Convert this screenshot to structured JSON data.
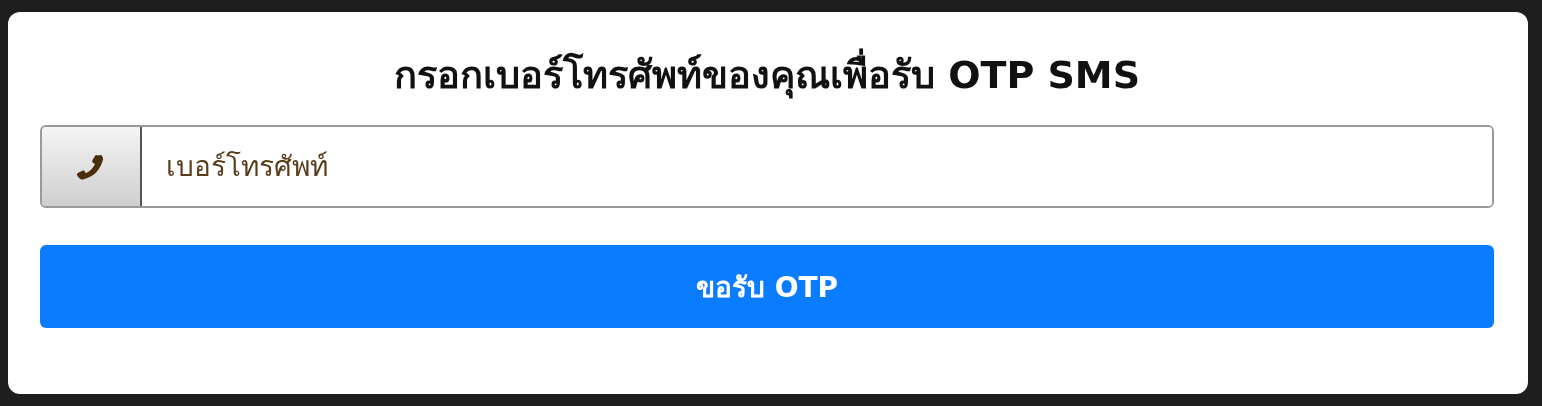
{
  "title": "กรอกเบอร์โทรศัพท์ของคุณเพื่อรับ OTP SMS",
  "phone_field": {
    "placeholder": "เบอร์โทรศัพท์"
  },
  "submit_button": {
    "label": "ขอรับ OTP"
  }
}
